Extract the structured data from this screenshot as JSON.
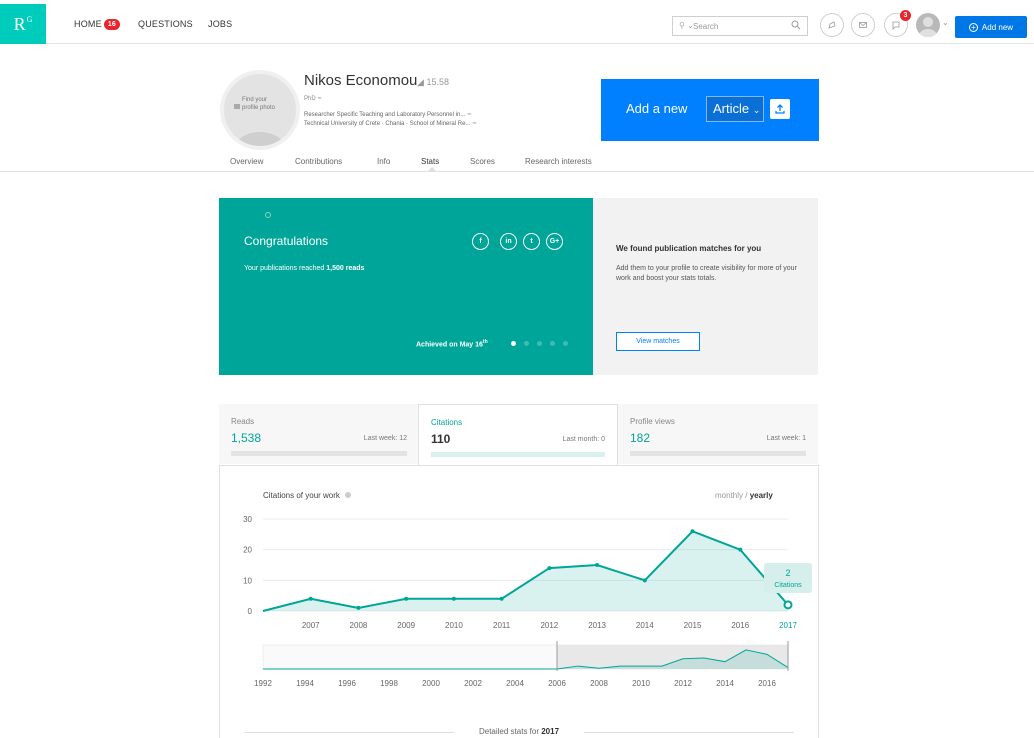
{
  "nav": {
    "logo": "R",
    "logo_sup": "G",
    "home": "HOME",
    "home_badge": "16",
    "questions": "QUESTIONS",
    "jobs": "JOBS",
    "search_placeholder": "Search",
    "notif_badge": "3",
    "add_new": "Add new"
  },
  "profile": {
    "photo_hint": "Find your profile photo",
    "name": "Nikos Economou",
    "score": "15.58",
    "degree": "PhD",
    "position": "Researcher Specific Teaching and Laboratory Personnel in...",
    "institution": "Technical University of Crete · Chania · School of Mineral Re...",
    "add_label": "Add a new",
    "add_type": "Article"
  },
  "tabs": [
    "Overview",
    "Contributions",
    "Info",
    "Stats",
    "Scores",
    "Research interests"
  ],
  "congrats": {
    "title": "Congratulations",
    "message_prefix": "Your publications reached",
    "message_value": "1,500 reads",
    "achieved": "Achieved on May 16",
    "achieved_sup": "th",
    "social": [
      "f",
      "in",
      "t",
      "G+"
    ]
  },
  "matches": {
    "heading": "We found publication matches for you",
    "text": "Add them to your profile to create visibility for more of your work and boost your stats totals.",
    "button": "View matches"
  },
  "stats": [
    {
      "label": "Reads",
      "value": "1,538",
      "period": "Last week: 12"
    },
    {
      "label": "Citations",
      "value": "110",
      "period": "Last month: 0"
    },
    {
      "label": "Profile views",
      "value": "182",
      "period": "Last week: 1"
    }
  ],
  "chart_header": {
    "title": "Citations of your work",
    "monthly": "monthly",
    "sep": " / ",
    "yearly": "yearly"
  },
  "chart_data": {
    "type": "area",
    "title": "Citations of your work",
    "x": [
      2006,
      2007,
      2008,
      2009,
      2010,
      2011,
      2012,
      2013,
      2014,
      2015,
      2016,
      2017
    ],
    "y": [
      0,
      4,
      1,
      4,
      4,
      4,
      14,
      15,
      10,
      26,
      20,
      2
    ],
    "x_ticks": [
      "2007",
      "2008",
      "2009",
      "2010",
      "2011",
      "2012",
      "2013",
      "2014",
      "2015",
      "2016",
      "2017"
    ],
    "y_ticks": [
      "0",
      "10",
      "20",
      "30"
    ],
    "ylim": [
      0,
      30
    ],
    "tooltip_value": "2",
    "tooltip_label": "Citations",
    "color": "#00a599",
    "overview_ticks": [
      "1992",
      "1994",
      "1996",
      "1998",
      "2000",
      "2002",
      "2004",
      "2006",
      "2008",
      "2010",
      "2012",
      "2014",
      "2016"
    ],
    "overview_range": [
      1992,
      2017
    ],
    "overview_selected": [
      2006,
      2017
    ]
  },
  "detailed": {
    "prefix": "Detailed stats for",
    "year": "2017"
  }
}
